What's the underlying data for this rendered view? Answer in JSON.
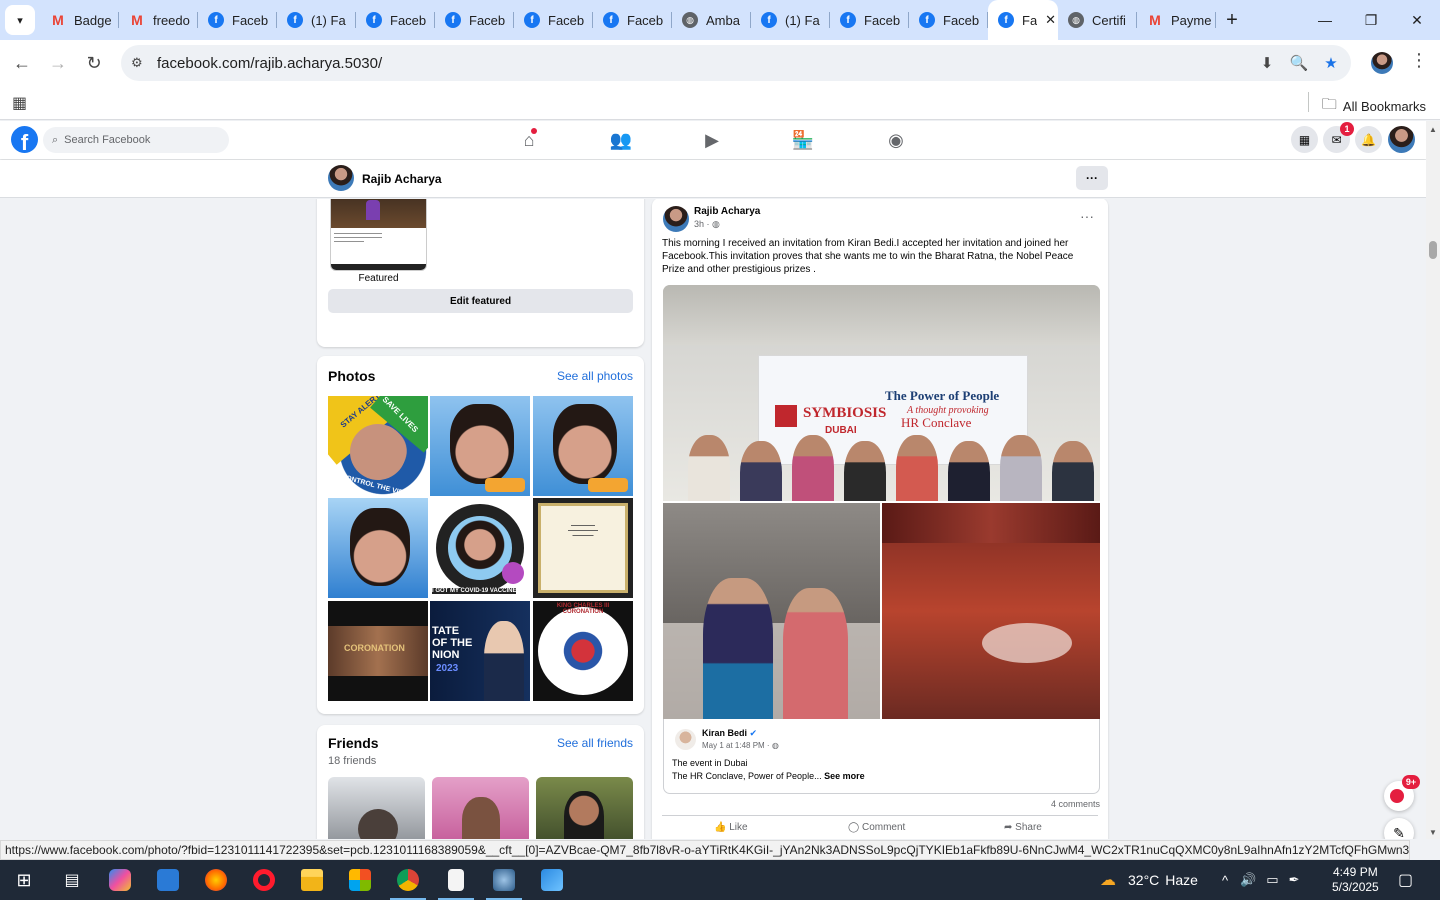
{
  "browser": {
    "tabs": [
      {
        "label": "Badge",
        "icon": "gmail-icon"
      },
      {
        "label": "freedo",
        "icon": "gmail-icon"
      },
      {
        "label": "Faceb",
        "icon": "facebook-icon"
      },
      {
        "label": "(1) Fa",
        "icon": "facebook-icon"
      },
      {
        "label": "Faceb",
        "icon": "facebook-icon"
      },
      {
        "label": "Faceb",
        "icon": "facebook-icon"
      },
      {
        "label": "Faceb",
        "icon": "facebook-icon"
      },
      {
        "label": "Faceb",
        "icon": "facebook-icon"
      },
      {
        "label": "Amba",
        "icon": "globe-icon"
      },
      {
        "label": "(1) Fa",
        "icon": "facebook-icon"
      },
      {
        "label": "Faceb",
        "icon": "facebook-icon"
      },
      {
        "label": "Faceb",
        "icon": "facebook-icon"
      },
      {
        "label": "Fa",
        "icon": "facebook-icon",
        "active": true
      },
      {
        "label": "Certifi",
        "icon": "globe-icon"
      },
      {
        "label": "Payme",
        "icon": "gmail-icon"
      }
    ],
    "url": "facebook.com/rajib.acharya.5030/",
    "all_bookmarks": "All Bookmarks",
    "status_url": "https://www.facebook.com/photo/?fbid=1231011141722395&set=pcb.1231011168389059&__cft__[0]=AZVBcae-QM7_8fb7l8vR-o-aYTiRtK4KGiI-_jYAn2Nk3ADNSSoL9pcQjTYKIEb1aFkfb89U-6NnCJwM4_WC2xTR1nuCqQXMC0y8nL9aIhnAfn1zY2MTcfQFhGMwn3ay..."
  },
  "facebook": {
    "search_placeholder": "Search Facebook",
    "messenger_badge": "1",
    "profile_name": "Rajib Acharya",
    "featured_label": "Featured",
    "edit_featured": "Edit featured",
    "photos_title": "Photos",
    "see_all_photos": "See all photos",
    "friends_title": "Friends",
    "see_all_friends": "See all friends",
    "friends_count": "18 friends",
    "post": {
      "author": "Rajib Acharya",
      "time": "3h ·",
      "text": "This morning I received an invitation from Kiran Bedi.I accepted her invitation and joined her Facebook.This invitation proves that she wants me to win the Bharat Ratna, the Nobel Peace Prize and other prestigious prizes .",
      "banner_title": "The Power of People",
      "banner_sub": "A thought provoking",
      "banner_event": "HR Conclave",
      "banner_brand": "SYMBIOSIS",
      "banner_city": "DUBAI",
      "shared_author": "Kiran Bedi",
      "shared_time": "May 1 at 1:48 PM ·",
      "shared_line1": "The event in Dubai",
      "shared_line2": "The HR Conclave, Power of People...",
      "see_more": "See more",
      "comments": "4 comments",
      "like": "Like",
      "comment": "Comment",
      "share": "Share"
    },
    "photo_texts": {
      "stay_alert": "STAY ALERT",
      "save_lives": "SAVE LIVES",
      "control_virus": "CONTROL THE VIRUS",
      "vaccine": "I GOT MY COVID-19 VACCINE",
      "coronation": "CORONATION",
      "state_union": "TATE OF THE NION",
      "year": "2023",
      "king_charles": "KING CHARLES III CORONATION"
    },
    "chat_badge": "9+"
  },
  "taskbar": {
    "temperature": "32°C",
    "weather": "Haze",
    "time": "4:49 PM",
    "date": "5/3/2025"
  }
}
